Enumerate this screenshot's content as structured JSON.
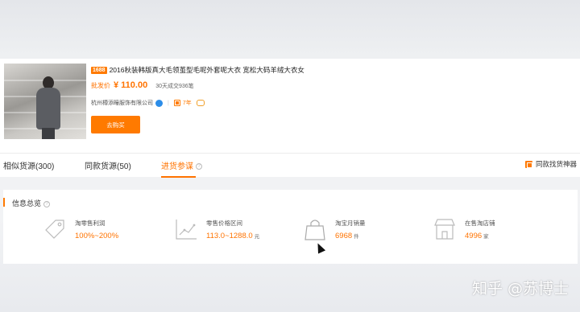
{
  "product": {
    "badge": "1688",
    "title": "2016秋装韩版真大毛领茧型毛呢外套呢大衣 宽松大码羊绒大衣女",
    "price_label": "批发价",
    "price": "¥ 110.00",
    "deal_count": "30天成交936笔",
    "shop_name": "杭州樽添疃服饰有限公司",
    "years": "7年",
    "buy_label": "去购买"
  },
  "tabs": {
    "similar": "相似货源(300)",
    "same": "同款货源(50)",
    "advisor": "进货参谋",
    "finder": "同款找货神器"
  },
  "overview": {
    "title": "信息总览",
    "stats": [
      {
        "label": "淘零售利润",
        "value": "100%~200%",
        "unit": ""
      },
      {
        "label": "零售价格区间",
        "value": "113.0~1288.0",
        "unit": "元"
      },
      {
        "label": "淘宝月销量",
        "value": "6968",
        "unit": "件"
      },
      {
        "label": "在售淘店铺",
        "value": "4996",
        "unit": "家"
      }
    ]
  },
  "watermark": "知乎 @苏博士",
  "colors": {
    "accent": "#ff7300",
    "badge": "#ff7a00",
    "verified": "#2c8de8"
  }
}
